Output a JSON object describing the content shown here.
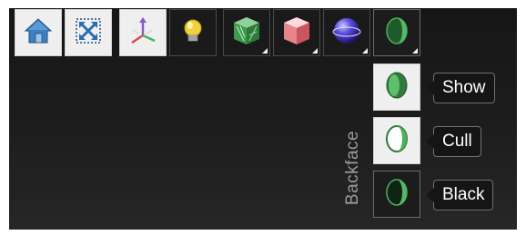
{
  "toolbar": {
    "buttons": [
      {
        "name": "home-view-button",
        "icon": "house-icon"
      },
      {
        "name": "zoom-fit-button",
        "icon": "fit-view-icon"
      },
      {
        "name": "axes-button",
        "icon": "xyz-axes-icon"
      },
      {
        "name": "lighting-button",
        "icon": "light-bulb-icon"
      },
      {
        "name": "wireframe-render-button",
        "icon": "green-shaded-cube-icon"
      },
      {
        "name": "solid-render-button",
        "icon": "pink-cube-icon"
      },
      {
        "name": "material-button",
        "icon": "blue-sphere-icon"
      },
      {
        "name": "backface-button",
        "icon": "half-shaded-sphere-icon"
      }
    ]
  },
  "backface_menu": {
    "label": "Backface",
    "options": [
      {
        "label": "Show",
        "icon": "show-backface-icon"
      },
      {
        "label": "Cull",
        "icon": "cull-backface-icon"
      },
      {
        "label": "Black",
        "icon": "black-backface-icon"
      }
    ]
  },
  "colors": {
    "viewport_bg": "#1d1d1d",
    "button_light": "#efefef",
    "accent_green": "#4caf5a",
    "tooltip_bg": "#151515"
  }
}
